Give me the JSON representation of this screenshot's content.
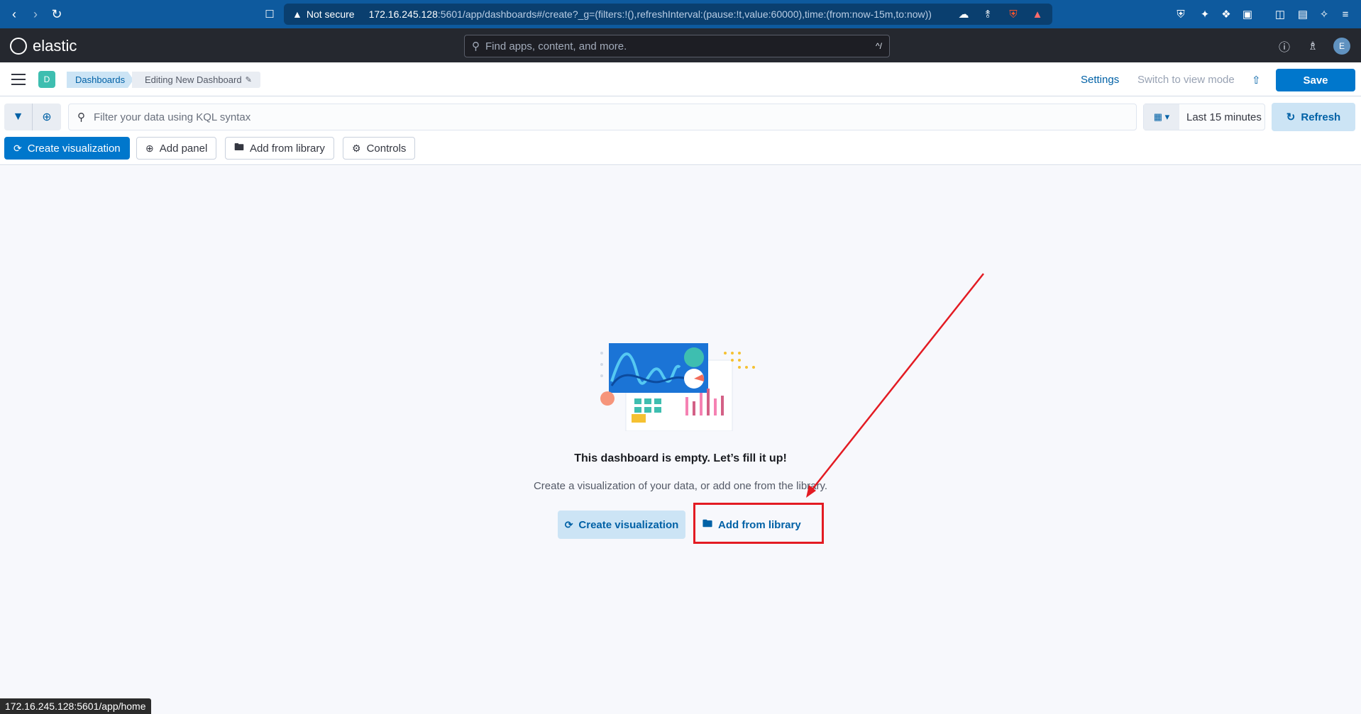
{
  "browser": {
    "not_secure": "Not secure",
    "url_host": "172.16.245.128",
    "url_path": ":5601/app/dashboards#/create?_g=(filters:!(),refreshInterval:(pause:!t,value:60000),time:(from:now-15m,to:now))"
  },
  "header": {
    "logo_text": "elastic",
    "search_placeholder": "Find apps, content, and more.",
    "search_shortcut": "^/",
    "avatar_initial": "E"
  },
  "breadcrumbs": {
    "space_initial": "D",
    "items": [
      "Dashboards",
      "Editing New Dashboard"
    ],
    "settings": "Settings",
    "view_mode": "Switch to view mode",
    "save": "Save"
  },
  "query": {
    "placeholder": "Filter your data using KQL syntax",
    "time_range": "Last 15 minutes",
    "refresh": "Refresh"
  },
  "toolbar": {
    "create_visualization": "Create visualization",
    "add_panel": "Add panel",
    "add_from_library": "Add from library",
    "controls": "Controls"
  },
  "empty_state": {
    "title": "This dashboard is empty. Let’s fill it up!",
    "subtitle": "Create a visualization of your data, or add one from the library.",
    "create_visualization": "Create visualization",
    "add_from_library": "Add from library"
  },
  "status_bar": {
    "url": "172.16.245.128:5601/app/home"
  },
  "colors": {
    "browser_chrome": "#0e5a9e",
    "header": "#25282f",
    "primary": "#0077cc",
    "annotation": "#e31b23"
  }
}
